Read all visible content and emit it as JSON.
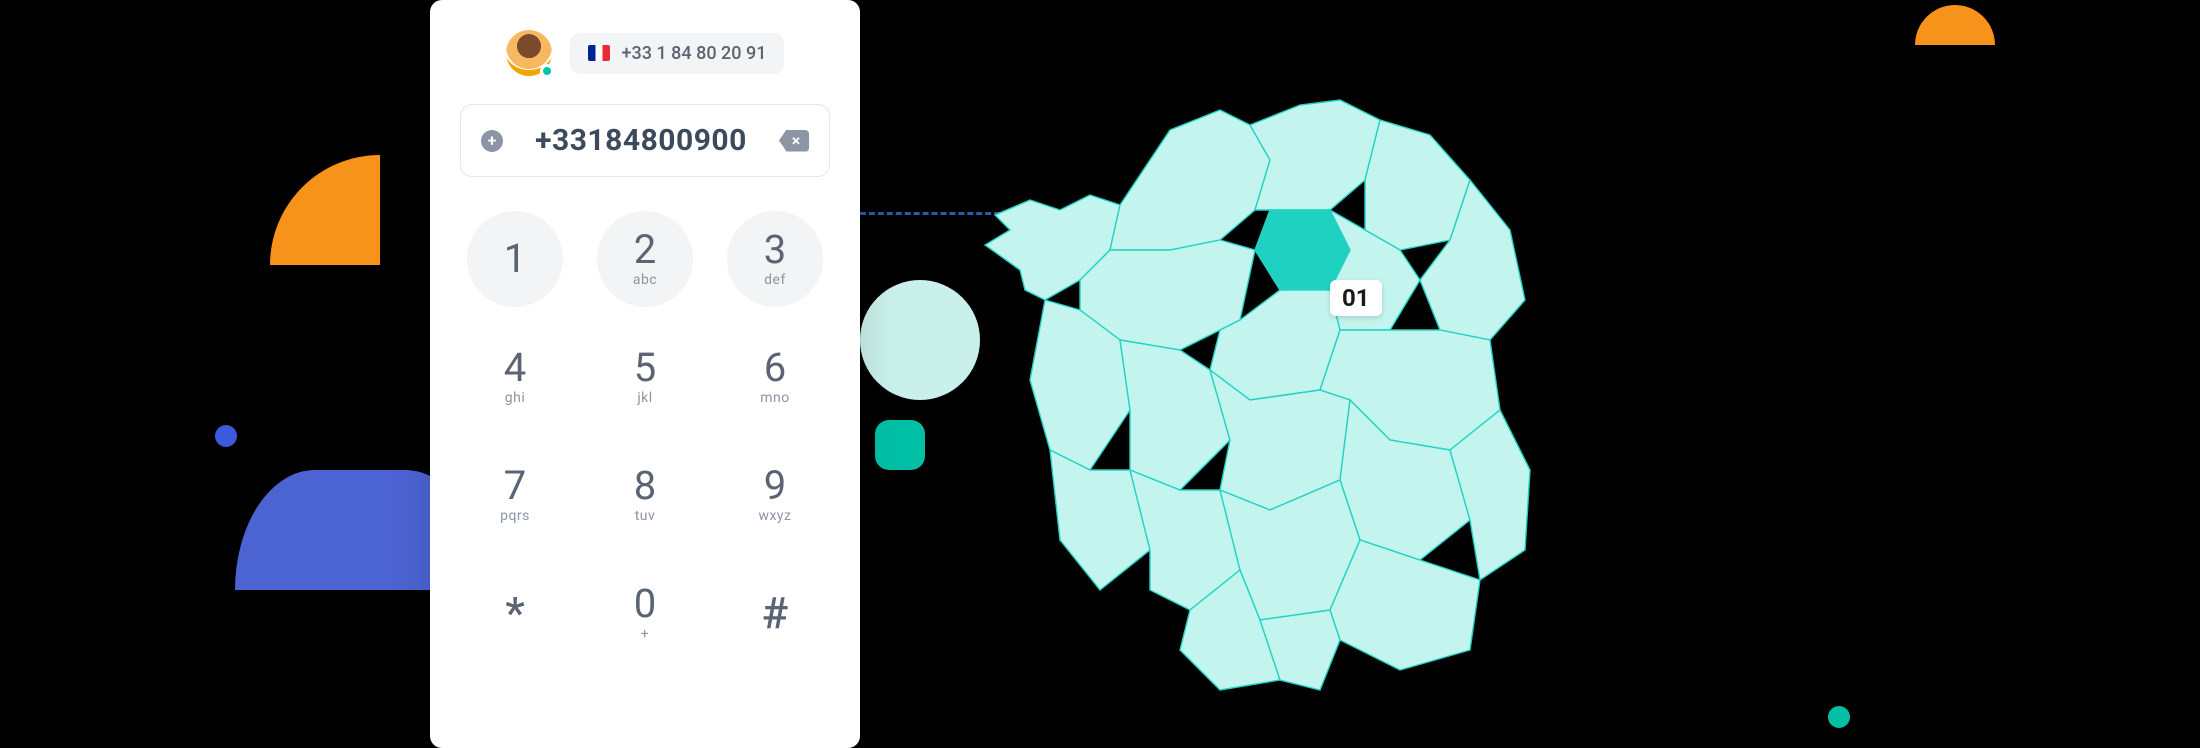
{
  "caller": {
    "display_number": "+33 1 84 80 20 91",
    "flag_name": "france-flag"
  },
  "dialer": {
    "current_value": "+33184800900"
  },
  "keypad": [
    {
      "digit": "1",
      "letters": "",
      "shaded": true
    },
    {
      "digit": "2",
      "letters": "abc",
      "shaded": true
    },
    {
      "digit": "3",
      "letters": "def",
      "shaded": true
    },
    {
      "digit": "4",
      "letters": "ghi",
      "shaded": false
    },
    {
      "digit": "5",
      "letters": "jkl",
      "shaded": false
    },
    {
      "digit": "6",
      "letters": "mno",
      "shaded": false
    },
    {
      "digit": "7",
      "letters": "pqrs",
      "shaded": false
    },
    {
      "digit": "8",
      "letters": "tuv",
      "shaded": false
    },
    {
      "digit": "9",
      "letters": "wxyz",
      "shaded": false
    },
    {
      "digit": "*",
      "letters": "",
      "shaded": false,
      "symbol": true
    },
    {
      "digit": "0",
      "letters": "+",
      "shaded": false
    },
    {
      "digit": "#",
      "letters": "",
      "shaded": false,
      "symbol": true
    }
  ],
  "map": {
    "region_code": "01",
    "country": "France"
  },
  "colors": {
    "accent_teal": "#00bfa5",
    "accent_orange": "#f7931a",
    "accent_blue": "#4c63d2",
    "map_fill": "#c3f5ee",
    "map_stroke": "#22d3c5",
    "map_highlight": "#1fd1c1"
  }
}
